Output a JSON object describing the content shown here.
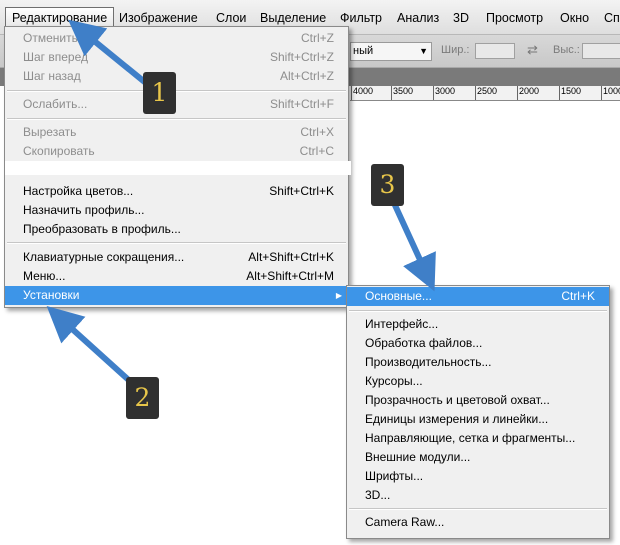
{
  "menubar": {
    "items": [
      "Редактирование",
      "Изображение",
      "Слои",
      "Выделение",
      "Фильтр",
      "Анализ",
      "3D",
      "Просмотр",
      "Окно",
      "Сп"
    ]
  },
  "options_bar": {
    "combo_value": "ный",
    "width_label": "Шир.:",
    "height_label": "Выс.:"
  },
  "ruler": {
    "labels": [
      "4000",
      "3500",
      "3000",
      "2500",
      "2000",
      "1500",
      "1000"
    ]
  },
  "edit_menu": {
    "items": [
      {
        "label": "Отменить",
        "shortcut": "Ctrl+Z",
        "disabled": true
      },
      {
        "label": "Шаг вперед",
        "shortcut": "Shift+Ctrl+Z",
        "disabled": true
      },
      {
        "label": "Шаг назад",
        "shortcut": "Alt+Ctrl+Z",
        "disabled": true
      },
      {
        "label": "Ослабить...",
        "shortcut": "Shift+Ctrl+F",
        "disabled": true
      },
      {
        "label": "Вырезать",
        "shortcut": "Ctrl+X",
        "disabled": true
      },
      {
        "label": "Скопировать",
        "shortcut": "Ctrl+C",
        "disabled": true
      },
      {
        "label": "Настройка цветов...",
        "shortcut": "Shift+Ctrl+K",
        "disabled": false
      },
      {
        "label": "Назначить профиль...",
        "shortcut": "",
        "disabled": false
      },
      {
        "label": "Преобразовать в профиль...",
        "shortcut": "",
        "disabled": false
      },
      {
        "label": "Клавиатурные сокращения...",
        "shortcut": "Alt+Shift+Ctrl+K",
        "disabled": false
      },
      {
        "label": "Меню...",
        "shortcut": "Alt+Shift+Ctrl+M",
        "disabled": false
      },
      {
        "label": "Установки",
        "shortcut": "",
        "disabled": false
      }
    ]
  },
  "preferences_submenu": {
    "items": [
      {
        "label": "Основные...",
        "shortcut": "Ctrl+K"
      },
      {
        "label": "Интерфейс...",
        "shortcut": ""
      },
      {
        "label": "Обработка файлов...",
        "shortcut": ""
      },
      {
        "label": "Производительность...",
        "shortcut": ""
      },
      {
        "label": "Курсоры...",
        "shortcut": ""
      },
      {
        "label": "Прозрачность и цветовой охват...",
        "shortcut": ""
      },
      {
        "label": "Единицы измерения и линейки...",
        "shortcut": ""
      },
      {
        "label": "Направляющие, сетка и фрагменты...",
        "shortcut": ""
      },
      {
        "label": "Внешние модули...",
        "shortcut": ""
      },
      {
        "label": "Шрифты...",
        "shortcut": ""
      },
      {
        "label": "3D...",
        "shortcut": ""
      },
      {
        "label": "Camera Raw...",
        "shortcut": ""
      }
    ]
  },
  "annotations": {
    "badges": [
      "1",
      "2",
      "3"
    ]
  },
  "colors": {
    "highlight": "#3d95e8",
    "arrow": "#3f7fc8",
    "badge_bg": "#303030",
    "badge_text": "#e8c64a"
  }
}
